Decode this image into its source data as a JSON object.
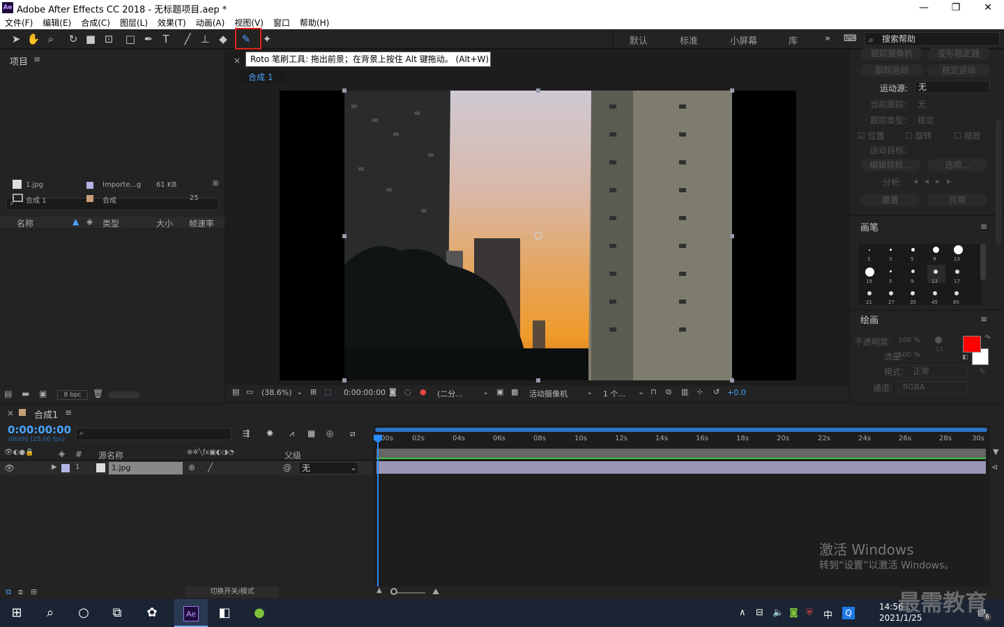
{
  "window": {
    "title": "Adobe After Effects CC 2018 - 无标题项目.aep *",
    "logo": "Ae",
    "minimize": "—",
    "maximize": "❐",
    "close": "✕"
  },
  "menu": [
    "文件(F)",
    "编辑(E)",
    "合成(C)",
    "图层(L)",
    "效果(T)",
    "动画(A)",
    "视图(V)",
    "窗口",
    "帮助(H)"
  ],
  "workspaces": [
    "默认",
    "标准",
    "小屏幕",
    "库"
  ],
  "search_help": {
    "placeholder": "搜索帮助"
  },
  "tooltip": "Roto 笔刷工具: 拖出前景；在背景上按住 Alt 键拖动。 (Alt+W)",
  "project": {
    "title": "项目",
    "columns": [
      "名称",
      "类型",
      "大小",
      "帧速率"
    ],
    "rows": [
      {
        "name": "1.jpg",
        "type": "Importe...g",
        "size": "61 KB",
        "fps": "",
        "color": "#b4b4e6"
      },
      {
        "name": "合成 1",
        "type": "合成",
        "size": "",
        "fps": "25",
        "color": "#c8a078"
      }
    ],
    "bpc": "8 bpc"
  },
  "viewer": {
    "comp_tab": "合成 1",
    "zoom": "(38.6%)",
    "timecode": "0:00:00:00",
    "resolution": "(二分...",
    "camera": "活动摄像机",
    "views": "1 个...",
    "exposure": "+0.0"
  },
  "tracker": {
    "buttons": [
      "跟踪摄像机",
      "变形稳定器",
      "跟踪运动",
      "稳定运动"
    ],
    "motion_source_label": "运动源:",
    "motion_source_value": "无",
    "current_track_label": "当前跟踪:",
    "current_track_value": "无",
    "track_type_label": "跟踪类型:",
    "track_type_value": "稳定",
    "position": "位置",
    "rotation": "旋转",
    "scale": "缩放",
    "motion_target": "运动目标:",
    "edit_target": "编辑目标...",
    "options": "选项...",
    "analyze": "分析:",
    "reset": "重置",
    "apply": "应用"
  },
  "brushes": {
    "title": "画笔",
    "sizes": [
      "1",
      "3",
      "5",
      "9",
      "13",
      "19",
      "5",
      "9",
      "13",
      "17",
      "21",
      "27",
      "35",
      "45",
      "65"
    ]
  },
  "paint": {
    "title": "绘画",
    "opacity_label": "不透明度:",
    "opacity": "100 %",
    "flow_label": "流量:",
    "flow": "100 %",
    "mode_label": "模式:",
    "mode": "正常",
    "channel_label": "通道:",
    "channel": "RGBA",
    "brush_size": "13",
    "fg_color": "#ff0000",
    "bg_color": "#ffffff"
  },
  "timeline": {
    "comp_name": "合成1",
    "timecode": "0:00:00:00",
    "frame_info": "00000 (25.00 fps)",
    "columns": {
      "num": "#",
      "source": "源名称",
      "parent": "父级"
    },
    "layer": {
      "num": "1",
      "name": "1.jpg",
      "parent": "无"
    },
    "ticks": [
      "00s",
      "02s",
      "04s",
      "06s",
      "08s",
      "10s",
      "12s",
      "14s",
      "16s",
      "18s",
      "20s",
      "22s",
      "24s",
      "26s",
      "28s",
      "30s"
    ],
    "toggle": "切换开关/模式"
  },
  "watermark": {
    "line1": "激活 Windows",
    "line2": "转到“设置”以激活 Windows。",
    "brand": "最需教育"
  },
  "taskbar": {
    "time": "14:56",
    "date": "2021/1/25",
    "ime": "中",
    "notif": "6"
  }
}
